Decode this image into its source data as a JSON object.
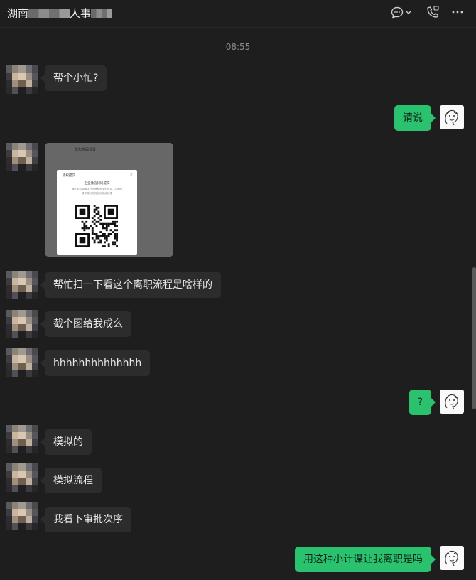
{
  "header": {
    "title_part1": "湖南",
    "title_part2": "人事",
    "icons": [
      "chat-bubble-icon",
      "chevron-down-icon",
      "phone-call-icon",
      "more-icon"
    ]
  },
  "timestamp": "08:55",
  "messages": [
    {
      "side": "left",
      "type": "text",
      "text": "帮个小忙?"
    },
    {
      "side": "right",
      "type": "text",
      "text": "请说"
    },
    {
      "side": "left",
      "type": "image",
      "image": {
        "caption": "帮扫描器设置",
        "dialog_title": "授权提交",
        "dialog_subtitle": "企业微信扫码提交",
        "dialog_line1": "请在手机端确认扫码授权相关的信息，并确认",
        "dialog_line2": "操作将以你的身份继续处理"
      }
    },
    {
      "side": "left",
      "type": "text",
      "text": "帮忙扫一下看这个离职流程是啥样的"
    },
    {
      "side": "left",
      "type": "text",
      "text": "截个图给我成么"
    },
    {
      "side": "left",
      "type": "text",
      "text": "hhhhhhhhhhhhhh"
    },
    {
      "side": "right",
      "type": "text",
      "text": "?"
    },
    {
      "side": "left",
      "type": "text",
      "text": "模拟的"
    },
    {
      "side": "left",
      "type": "text",
      "text": "模拟流程"
    },
    {
      "side": "left",
      "type": "text",
      "text": "我看下审批次序"
    },
    {
      "side": "right",
      "type": "text",
      "text": "用这种小计谋让我离职是吗"
    }
  ],
  "colors": {
    "background": "#1e1e1e",
    "incoming_bubble": "#2c2c2c",
    "outgoing_bubble": "#2bc26f",
    "timestamp": "#8a8a8a"
  }
}
